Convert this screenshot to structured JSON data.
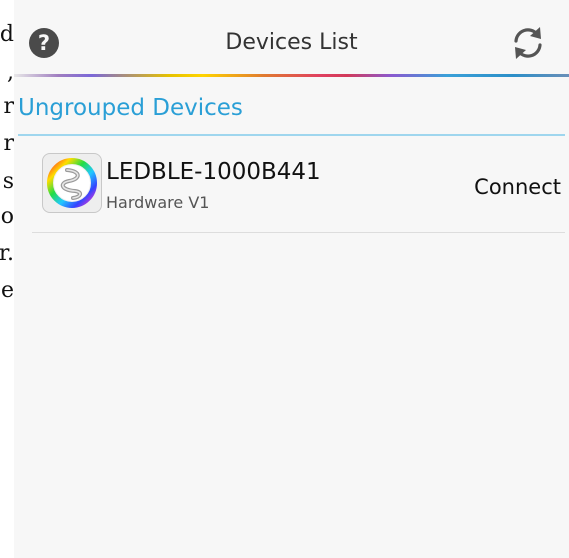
{
  "background_doc": {
    "lines": [
      "d",
      ",",
      "r",
      "r",
      "s",
      "o",
      "r.",
      "e"
    ]
  },
  "header": {
    "title": "Devices List",
    "help_icon": "help-icon",
    "help_glyph": "?",
    "refresh_icon": "refresh-icon"
  },
  "section": {
    "title": "Ungrouped Devices"
  },
  "devices": [
    {
      "name": "LEDBLE-1000B441",
      "subtitle": "Hardware V1",
      "action_label": "Connect",
      "icon": "led-strip-color-wheel-icon"
    }
  ],
  "colors": {
    "accent": "#2a9fd6",
    "screen_bg": "#f7f7f7",
    "text": "#111111"
  }
}
